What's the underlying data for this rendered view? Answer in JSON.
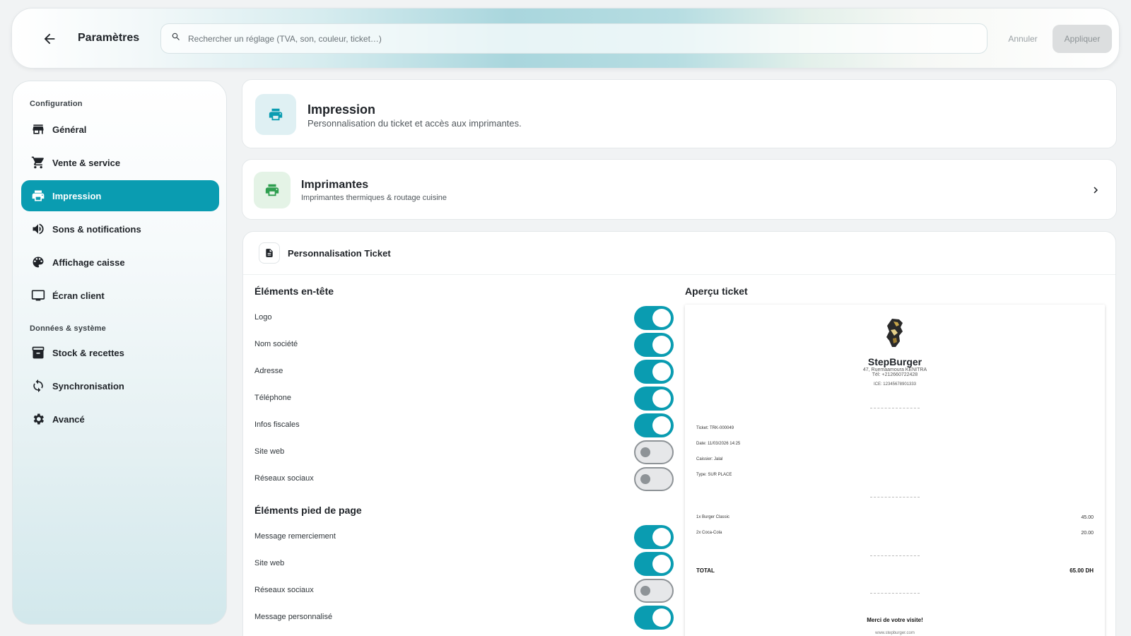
{
  "header": {
    "title": "Paramètres",
    "search_placeholder": "Rechercher un réglage (TVA, son, couleur, ticket…)",
    "cancel_label": "Annuler",
    "apply_label": "Appliquer"
  },
  "sidebar": {
    "section_config": "Configuration",
    "section_data": "Données & système",
    "items": [
      {
        "label": "Général",
        "icon": "store-icon"
      },
      {
        "label": "Vente & service",
        "icon": "cart-icon"
      },
      {
        "label": "Impression",
        "icon": "printer-icon",
        "active": true
      },
      {
        "label": "Sons & notifications",
        "icon": "volume-icon"
      },
      {
        "label": "Affichage caisse",
        "icon": "palette-icon"
      },
      {
        "label": "Écran client",
        "icon": "monitor-icon"
      },
      {
        "label": "Stock & recettes",
        "icon": "archive-icon"
      },
      {
        "label": "Synchronisation",
        "icon": "sync-icon"
      },
      {
        "label": "Avancé",
        "icon": "gear-icon"
      }
    ]
  },
  "impression": {
    "title": "Impression",
    "subtitle": "Personnalisation du ticket et accès aux imprimantes."
  },
  "printers": {
    "title": "Imprimantes",
    "subtitle": "Imprimantes thermiques & routage cuisine"
  },
  "ticket": {
    "title": "Personnalisation Ticket",
    "header_group": "Éléments en-tête",
    "footer_group": "Éléments pied de page",
    "preview_title": "Aperçu ticket",
    "header_rows": [
      {
        "label": "Logo",
        "on": true
      },
      {
        "label": "Nom société",
        "on": true
      },
      {
        "label": "Adresse",
        "on": true
      },
      {
        "label": "Téléphone",
        "on": true
      },
      {
        "label": "Infos fiscales",
        "on": true
      },
      {
        "label": "Site web",
        "on": false
      },
      {
        "label": "Réseaux sociaux",
        "on": false
      }
    ],
    "footer_rows": [
      {
        "label": "Message remerciement",
        "on": true
      },
      {
        "label": "Site web",
        "on": true
      },
      {
        "label": "Réseaux sociaux",
        "on": false
      },
      {
        "label": "Message personnalisé",
        "on": true
      }
    ]
  },
  "receipt": {
    "company": "StepBurger",
    "address": "47, Ruemaamoura KENITRA",
    "phone": "Tél: +212660722428",
    "ice": "ICE: 12345678901333",
    "ticket_no": "Ticket: TRK-000049",
    "date": "Date: 11/03/2026 14:25",
    "cashier": "Caissier: Jalal",
    "type": "Type: SUR PLACE",
    "items": [
      {
        "label": "1x Burger Classic",
        "amount": "45.00"
      },
      {
        "label": "2x Coca-Cola",
        "amount": "20.00"
      }
    ],
    "total_label": "TOTAL",
    "total_value": "65.00 DH",
    "thanks": "Merci de votre visite!",
    "website": "www.stepburger.com"
  },
  "colors": {
    "accent": "#0a9cb1",
    "printer_green": "#2e9e4f"
  }
}
